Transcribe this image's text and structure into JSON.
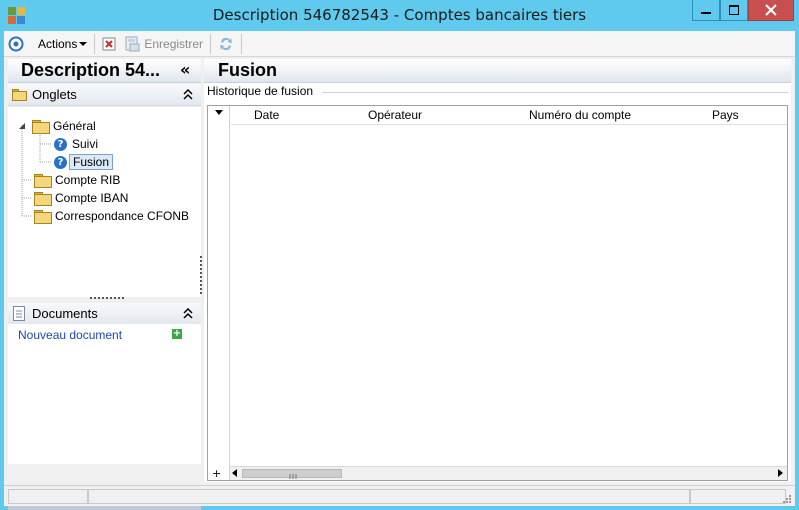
{
  "window": {
    "title": "Description 546782543 -  Comptes bancaires tiers",
    "minimize": "▁",
    "maximize": "□",
    "close": "✕"
  },
  "toolbar": {
    "actions_label": "Actions",
    "save_label": "Enregistrer"
  },
  "left": {
    "title": "Description 54...",
    "collapse": "«",
    "tabs_section": "Onglets",
    "documents_section": "Documents",
    "new_document": "Nouveau document",
    "tree": [
      {
        "label": "Général",
        "expand": "◢"
      },
      {
        "label": "Suivi"
      },
      {
        "label": "Fusion"
      },
      {
        "label": "Compte RIB"
      },
      {
        "label": "Compte IBAN"
      },
      {
        "label": "Correspondance CFONB"
      }
    ]
  },
  "right": {
    "title": "Fusion",
    "group": "Historique de fusion",
    "columns": [
      "Date",
      "Opérateur",
      "Numéro du compte",
      "Pays"
    ]
  },
  "icons": {
    "help": "?",
    "chevron_up": "⌃",
    "add": "+"
  }
}
